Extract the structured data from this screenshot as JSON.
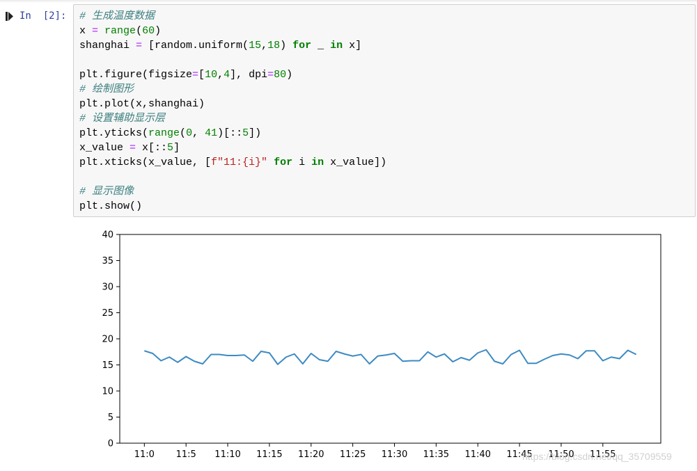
{
  "cell": {
    "prompt": "In  [2]:",
    "code_lines": [
      [
        {
          "t": "cm",
          "v": "# 生成温度数据"
        }
      ],
      [
        {
          "t": "",
          "v": "x "
        },
        {
          "t": "op",
          "v": "="
        },
        {
          "t": "",
          "v": " "
        },
        {
          "t": "bi",
          "v": "range"
        },
        {
          "t": "",
          "v": "("
        },
        {
          "t": "nm",
          "v": "60"
        },
        {
          "t": "",
          "v": ")"
        }
      ],
      [
        {
          "t": "",
          "v": "shanghai "
        },
        {
          "t": "op",
          "v": "="
        },
        {
          "t": "",
          "v": " [random.uniform("
        },
        {
          "t": "nm",
          "v": "15"
        },
        {
          "t": "",
          "v": ","
        },
        {
          "t": "nm",
          "v": "18"
        },
        {
          "t": "",
          "v": ") "
        },
        {
          "t": "kw",
          "v": "for"
        },
        {
          "t": "",
          "v": " _ "
        },
        {
          "t": "kw",
          "v": "in"
        },
        {
          "t": "",
          "v": " x]"
        }
      ],
      [
        {
          "t": "",
          "v": ""
        }
      ],
      [
        {
          "t": "",
          "v": "plt.figure(figsize"
        },
        {
          "t": "op",
          "v": "="
        },
        {
          "t": "",
          "v": "["
        },
        {
          "t": "nm",
          "v": "10"
        },
        {
          "t": "",
          "v": ","
        },
        {
          "t": "nm",
          "v": "4"
        },
        {
          "t": "",
          "v": "], dpi"
        },
        {
          "t": "op",
          "v": "="
        },
        {
          "t": "nm",
          "v": "80"
        },
        {
          "t": "",
          "v": ")"
        }
      ],
      [
        {
          "t": "cm",
          "v": "# 绘制图形"
        }
      ],
      [
        {
          "t": "",
          "v": "plt.plot(x,shanghai)"
        }
      ],
      [
        {
          "t": "cm",
          "v": "# 设置辅助显示层"
        }
      ],
      [
        {
          "t": "",
          "v": "plt.yticks("
        },
        {
          "t": "bi",
          "v": "range"
        },
        {
          "t": "",
          "v": "("
        },
        {
          "t": "nm",
          "v": "0"
        },
        {
          "t": "",
          "v": ", "
        },
        {
          "t": "nm",
          "v": "41"
        },
        {
          "t": "",
          "v": ")[::"
        },
        {
          "t": "nm",
          "v": "5"
        },
        {
          "t": "",
          "v": "])"
        }
      ],
      [
        {
          "t": "",
          "v": "x_value "
        },
        {
          "t": "op",
          "v": "="
        },
        {
          "t": "",
          "v": " x[::"
        },
        {
          "t": "nm",
          "v": "5"
        },
        {
          "t": "",
          "v": "]"
        }
      ],
      [
        {
          "t": "",
          "v": "plt.xticks(x_value, ["
        },
        {
          "t": "st",
          "v": "f\"11:{i}\""
        },
        {
          "t": "",
          "v": " "
        },
        {
          "t": "kw",
          "v": "for"
        },
        {
          "t": "",
          "v": " i "
        },
        {
          "t": "kw",
          "v": "in"
        },
        {
          "t": "",
          "v": " x_value])"
        }
      ],
      [
        {
          "t": "",
          "v": ""
        }
      ],
      [
        {
          "t": "cm",
          "v": "# 显示图像"
        }
      ],
      [
        {
          "t": "",
          "v": "plt.show()"
        }
      ]
    ]
  },
  "colors": {
    "line": "#3d8ac2",
    "prompt": "#303f9f"
  },
  "icons": {
    "run": "run-cell-icon"
  },
  "watermark": "https://blog.csdn.net/qq_35709559",
  "chart_data": {
    "type": "line",
    "ylim": [
      0,
      40
    ],
    "xlim": [
      -2.95,
      61.95
    ],
    "yticks": [
      0,
      5,
      10,
      15,
      20,
      25,
      30,
      35,
      40
    ],
    "xticks": [
      0,
      5,
      10,
      15,
      20,
      25,
      30,
      35,
      40,
      45,
      50,
      55
    ],
    "xticklabels": [
      "11:0",
      "11:5",
      "11:10",
      "11:15",
      "11:20",
      "11:25",
      "11:30",
      "11:35",
      "11:40",
      "11:45",
      "11:50",
      "11:55"
    ],
    "x": [
      0,
      1,
      2,
      3,
      4,
      5,
      6,
      7,
      8,
      9,
      10,
      11,
      12,
      13,
      14,
      15,
      16,
      17,
      18,
      19,
      20,
      21,
      22,
      23,
      24,
      25,
      26,
      27,
      28,
      29,
      30,
      31,
      32,
      33,
      34,
      35,
      36,
      37,
      38,
      39,
      40,
      41,
      42,
      43,
      44,
      45,
      46,
      47,
      48,
      49,
      50,
      51,
      52,
      53,
      54,
      55,
      56,
      57,
      58,
      59
    ],
    "series": [
      {
        "values": [
          17.7,
          17.2,
          15.8,
          16.5,
          15.5,
          16.6,
          15.7,
          15.2,
          17.0,
          17.0,
          16.8,
          16.8,
          16.9,
          15.7,
          17.6,
          17.3,
          15.1,
          16.5,
          17.1,
          15.2,
          17.2,
          16.0,
          15.7,
          17.6,
          17.1,
          16.7,
          17.0,
          15.2,
          16.7,
          16.9,
          17.2,
          15.7,
          15.8,
          15.8,
          17.5,
          16.5,
          17.1,
          15.6,
          16.4,
          15.9,
          17.3,
          17.9,
          15.7,
          15.2,
          17.0,
          17.8,
          15.3,
          15.3,
          16.1,
          16.8,
          17.1,
          16.9,
          16.2,
          17.7,
          17.7,
          15.8,
          16.5,
          16.2,
          17.8,
          17.0
        ]
      }
    ]
  }
}
